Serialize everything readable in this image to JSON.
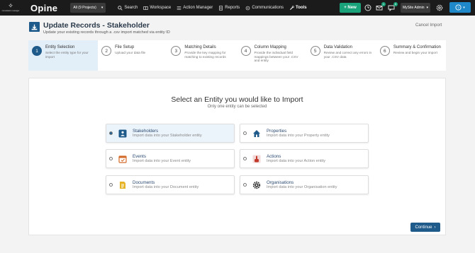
{
  "nav": {
    "logo_mark": "✧",
    "logo_sub": "consultation manager",
    "brand": "Opine",
    "project_select": "All (9 Projects)",
    "links": {
      "search": "Search",
      "workspace": "Workspace",
      "action_manager": "Action Manager",
      "reports": "Reports",
      "communications": "Communications",
      "tools": "Tools"
    },
    "new_button": "+ New",
    "mail_badge": "1",
    "notif_badge": "6",
    "admin_select": "MySite Admin",
    "accent": "#1aa37a",
    "help_color": "#1e88c9"
  },
  "header": {
    "title": "Update Records - Stakeholder",
    "subtitle": "Update your existing records through a .csv import matched via entity ID",
    "cancel": "Cancel Import"
  },
  "steps": [
    {
      "num": "1",
      "title": "Entity Selection",
      "desc": "Select the entity type for your import"
    },
    {
      "num": "2",
      "title": "File Setup",
      "desc": "Upload your data file"
    },
    {
      "num": "3",
      "title": "Matching Details",
      "desc": "Provide the key mapping for matching to existing records"
    },
    {
      "num": "4",
      "title": "Column Mapping",
      "desc": "Provide the individual field mappings between your .CSV and entity"
    },
    {
      "num": "5",
      "title": "Data Validation",
      "desc": "Review and correct any errors in your .CSV data"
    },
    {
      "num": "6",
      "title": "Summary & Confirmation",
      "desc": "Review and begin your import"
    }
  ],
  "main": {
    "title": "Select an Entity you would like to Import",
    "subtitle": "Only one entity can be selected",
    "entities": [
      {
        "name": "Stakeholders",
        "desc": "Import data into your Stakeholder entity",
        "icon": "stakeholders-icon"
      },
      {
        "name": "Properties",
        "desc": "Import data into your Property entity",
        "icon": "house-icon"
      },
      {
        "name": "Events",
        "desc": "Import data into your Event entity",
        "icon": "calendar-icon"
      },
      {
        "name": "Actions",
        "desc": "Import data into your Action entity",
        "icon": "hand-pointer-icon"
      },
      {
        "name": "Documents",
        "desc": "Import data into your Document entity",
        "icon": "document-icon"
      },
      {
        "name": "Organisations",
        "desc": "Import data into your Organisation entity",
        "icon": "gear-icon"
      }
    ],
    "continue": "Continue"
  }
}
